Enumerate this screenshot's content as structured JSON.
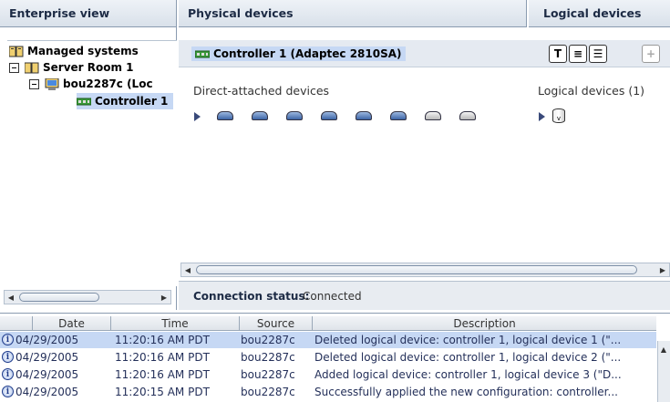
{
  "headers": {
    "enterprise": "Enterprise view",
    "physical": "Physical devices",
    "logical": "Logical devices"
  },
  "tree": {
    "managed": "Managed systems",
    "room": "Server Room 1",
    "server": "bou2287c (Loc",
    "controller": "Controller 1"
  },
  "controller_bar": {
    "label": "Controller 1 (Adaptec 2810SA)",
    "view_buttons": [
      "T",
      "≡",
      "☰",
      "+"
    ]
  },
  "devices": {
    "direct_label": "Direct-attached devices",
    "logical_label": "Logical devices (1)",
    "disk_colors": [
      "blue",
      "blue",
      "blue",
      "blue",
      "blue",
      "blue",
      "gray",
      "gray"
    ],
    "logical_icon": "v"
  },
  "connection": {
    "label": "Connection status:",
    "value": "Connected"
  },
  "log": {
    "columns": [
      "Date",
      "Time",
      "Source",
      "Description"
    ],
    "rows": [
      {
        "date": "04/29/2005",
        "time": "11:20:16 AM PDT",
        "source": "bou2287c",
        "description": "Deleted logical device: controller 1, logical device 1 (\"...",
        "selected": true
      },
      {
        "date": "04/29/2005",
        "time": "11:20:16 AM PDT",
        "source": "bou2287c",
        "description": "Deleted logical device: controller 1, logical device 2 (\"...",
        "selected": false
      },
      {
        "date": "04/29/2005",
        "time": "11:20:16 AM PDT",
        "source": "bou2287c",
        "description": "Added logical device: controller 1, logical device 3 (\"D...",
        "selected": false
      },
      {
        "date": "04/29/2005",
        "time": "11:20:15 AM PDT",
        "source": "bou2287c",
        "description": "Successfully applied the new configuration: controller...",
        "selected": false
      }
    ]
  },
  "colors": {
    "selection": "#c6d8f4",
    "header_text": "#1d2b45"
  }
}
